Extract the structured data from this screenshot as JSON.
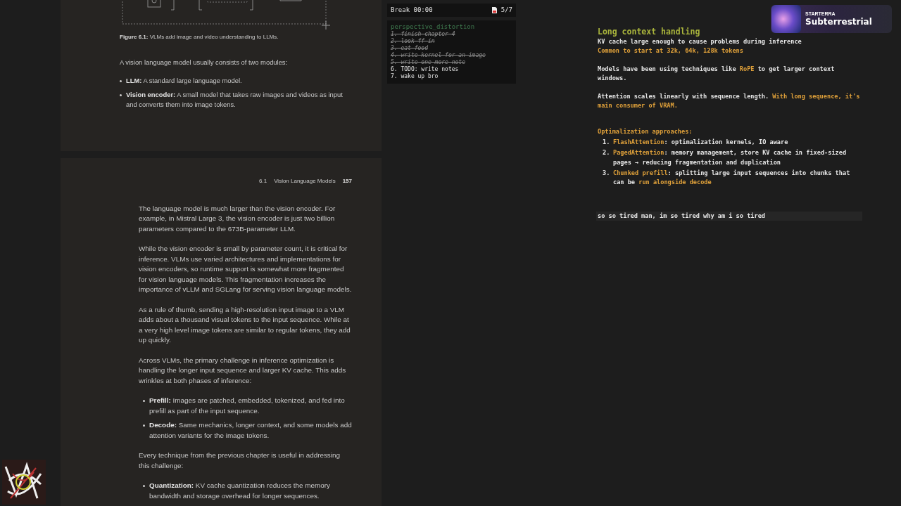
{
  "pdf": {
    "figure_caption": {
      "label": "Figure 6.1:",
      "text": "VLMs add image and video understanding to LLMs."
    },
    "page1": [
      {
        "kind": "paragraph",
        "text": "A vision language model usually consists of two modules:"
      },
      {
        "kind": "bullets",
        "items": [
          {
            "term": "LLM:",
            "text": "A standard large language model."
          },
          {
            "term": "Vision encoder:",
            "text": "A small model that takes raw images and videos as input and converts them into image tokens."
          }
        ]
      }
    ],
    "header": {
      "section": "6.1",
      "title": "Vision Language Models",
      "page": "157"
    },
    "page2": [
      {
        "kind": "paragraph",
        "text": "The language model is much larger than the vision encoder. For example, in Mistral Large 3, the vision encoder is just two billion parameters compared to the 673B-parameter LLM."
      },
      {
        "kind": "paragraph",
        "text": "While the vision encoder is small by parameter count, it is critical for inference. VLMs use varied architectures and implementations for vision encoders, so runtime support is somewhat more fragmented for vision language models. This fragmentation increases the importance of vLLM and SGLang for serving vision language models."
      },
      {
        "kind": "paragraph",
        "text": "As a rule of thumb, sending a high-resolution input image to a VLM adds about a thousand visual tokens to the input sequence. While at a very high level image tokens are similar to regular tokens, they add up quickly."
      },
      {
        "kind": "paragraph",
        "text": "Across VLMs, the primary challenge in inference optimization is handling the longer input sequence and larger KV cache. This adds wrinkles at both phases of inference:"
      },
      {
        "kind": "bullets",
        "items": [
          {
            "term": "Prefill:",
            "text": "Images are patched, embedded, tokenized, and fed into prefill as part of the input sequence."
          },
          {
            "term": "Decode:",
            "text": "Same mechanics, longer context, and some models add attention variants for the image tokens."
          }
        ]
      },
      {
        "kind": "paragraph",
        "text": "Every technique from the previous chapter is useful in addressing this challenge:"
      },
      {
        "kind": "bullets",
        "items": [
          {
            "term": "Quantization:",
            "text": "KV cache quantization reduces the memory bandwidth and storage overhead for longer sequences."
          }
        ]
      }
    ]
  },
  "timer": {
    "label": "Break 00:00",
    "count": "5/7"
  },
  "todo": {
    "title": "perspective_distortion",
    "items": [
      {
        "text": "1. finish chapter 4",
        "done": true
      },
      {
        "text": "2. look ff in",
        "done": true
      },
      {
        "text": "3. eat food",
        "done": true
      },
      {
        "text": "4. write kernel for an image",
        "done": true
      },
      {
        "text": "5. write one more note",
        "done": true
      },
      {
        "text": "6. TODO: write notes",
        "done": false
      },
      {
        "text": "7. wake up bro",
        "done": false
      }
    ]
  },
  "notes": {
    "heading": "Long context handling",
    "blocks": [
      {
        "kind": "lines",
        "lines": [
          [
            {
              "text": "KV cache large enough to cause problems during inference",
              "highlight": false
            }
          ],
          [
            {
              "text": "Common to start at 32k, 64k, 128k tokens",
              "highlight": true
            }
          ]
        ]
      },
      {
        "kind": "lines",
        "lines": [
          [
            {
              "text": "Models have been using techniques like ",
              "highlight": false
            },
            {
              "text": "RoPE",
              "highlight": true
            },
            {
              "text": " to get larger context windows.",
              "highlight": false
            }
          ]
        ]
      },
      {
        "kind": "lines",
        "lines": [
          [
            {
              "text": "Attention scales linearly with sequence length. ",
              "highlight": false
            },
            {
              "text": "With long sequence, it's main consumer of VRAM.",
              "highlight": true
            }
          ]
        ]
      },
      {
        "kind": "list",
        "title": "Optimalization approaches:",
        "items": [
          {
            "marker": "1.",
            "parts": [
              {
                "text": "FlashAttention",
                "highlight": true
              },
              {
                "text": ": optimalization kernels, IO aware",
                "highlight": false
              }
            ]
          },
          {
            "marker": "2.",
            "parts": [
              {
                "text": "PagedAttention",
                "highlight": true
              },
              {
                "text": ": memory management, store KV cache in fixed-sized pages → reducing fragmentation and duplication",
                "highlight": false
              }
            ]
          },
          {
            "marker": "3.",
            "parts": [
              {
                "text": "Chunked prefill",
                "highlight": true
              },
              {
                "text": ": splitting large input sequences into chunks that can be ",
                "highlight": false
              },
              {
                "text": "run alongside decode",
                "highlight": true
              }
            ]
          }
        ]
      },
      {
        "kind": "current_line",
        "text": "so so tired man, im so tired why am i so tired"
      }
    ]
  },
  "now_playing": {
    "artist": "STARTERRA",
    "track": "Subterrestrial"
  }
}
